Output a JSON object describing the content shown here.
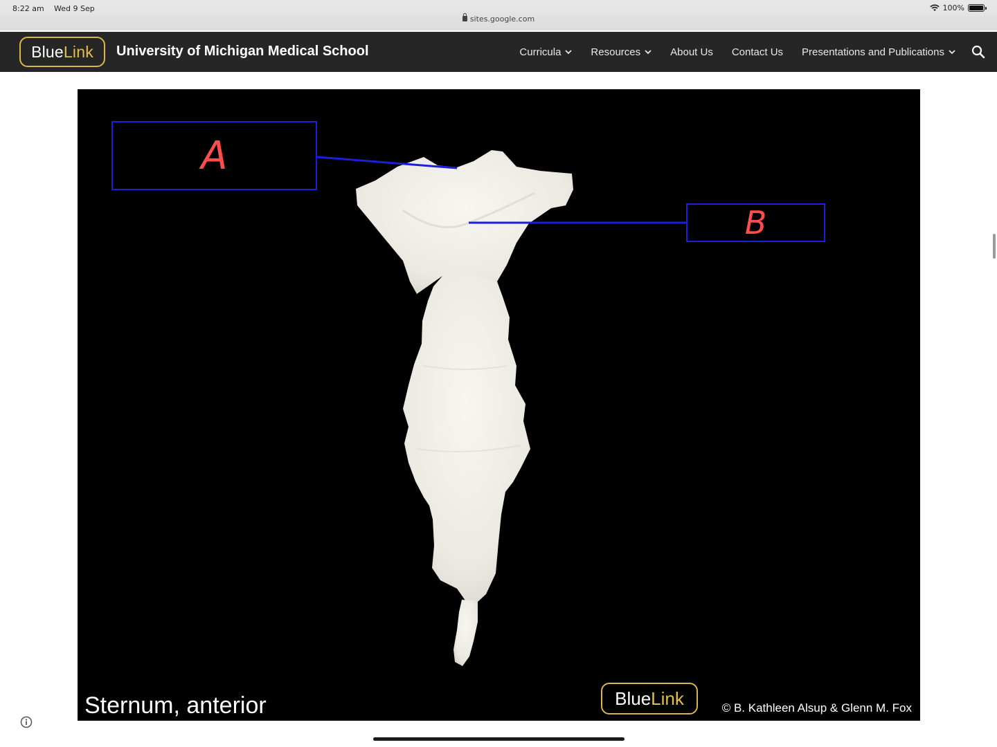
{
  "status_bar": {
    "time": "8:22 am",
    "date": "Wed 9 Sep",
    "battery": "100%",
    "url": "sites.google.com"
  },
  "header": {
    "logo": {
      "blue": "Blue",
      "link": "Link"
    },
    "title": "University of Michigan Medical School",
    "nav": [
      {
        "label": "Curricula",
        "has_dropdown": true
      },
      {
        "label": "Resources",
        "has_dropdown": true
      },
      {
        "label": "About Us",
        "has_dropdown": false
      },
      {
        "label": "Contact Us",
        "has_dropdown": false
      },
      {
        "label": "Presentations and Publications",
        "has_dropdown": true
      }
    ]
  },
  "figure": {
    "label_a": "A",
    "label_b": "B",
    "caption": "Sternum, anterior",
    "watermark": {
      "blue": "Blue",
      "link": "Link"
    },
    "credit": "© B. Kathleen Alsup & Glenn M. Fox"
  },
  "colors": {
    "header_bg": "#262626",
    "logo_gold": "#d8b84a",
    "leader_blue": "#1c1ed8",
    "label_red": "#ff4d4d",
    "bone": "#f1f0ea"
  }
}
